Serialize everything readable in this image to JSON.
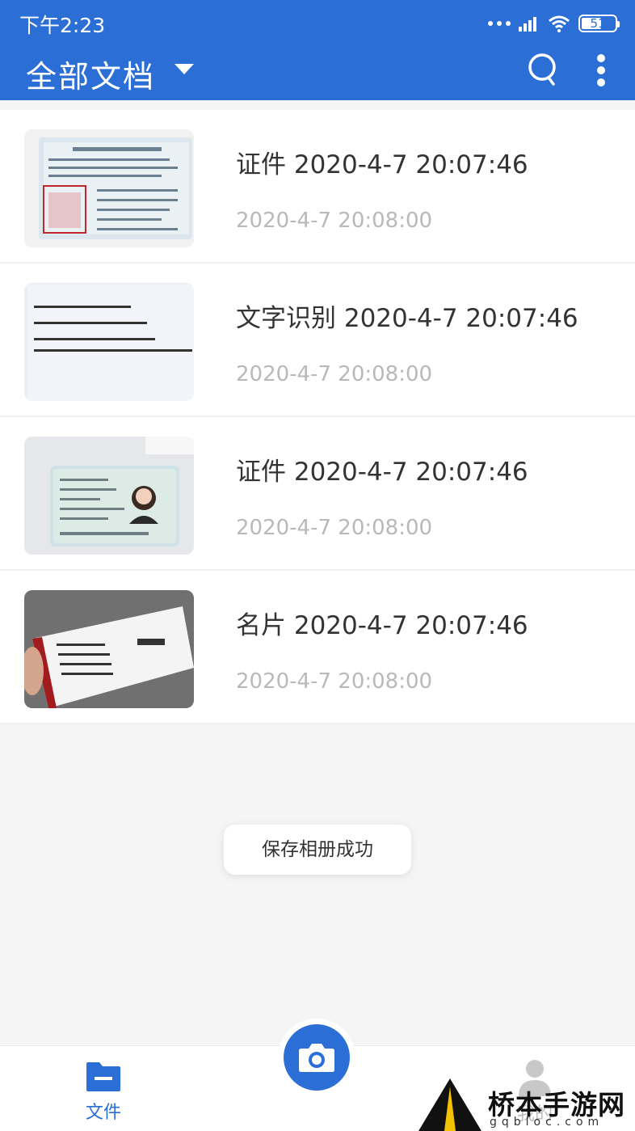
{
  "status_bar": {
    "time": "下午2:23",
    "battery": "51"
  },
  "header": {
    "title": "全部文档"
  },
  "documents": [
    {
      "title": "证件 2020-4-7 20:07:46",
      "date": "2020-4-7 20:08:00",
      "thumb": "driver-license"
    },
    {
      "title": "文字识别 2020-4-7 20:07:46",
      "date": "2020-4-7 20:08:00",
      "thumb": "text-document"
    },
    {
      "title": "证件 2020-4-7 20:07:46",
      "date": "2020-4-7 20:08:00",
      "thumb": "id-card"
    },
    {
      "title": "名片 2020-4-7 20:07:46",
      "date": "2020-4-7 20:08:00",
      "thumb": "business-card"
    }
  ],
  "toast": {
    "message": "保存相册成功"
  },
  "bottom_nav": {
    "files_label": "文件",
    "mine_label": "我的"
  },
  "watermark": {
    "title": "桥本手游网",
    "domain": "gqbloc.com"
  },
  "colors": {
    "primary": "#2b6fd6",
    "date_text": "#b9b9b9",
    "background": "#f5f5f5"
  },
  "icons": [
    "search-icon",
    "more-vertical-icon",
    "dropdown-caret-icon",
    "folder-icon",
    "camera-icon",
    "user-icon"
  ]
}
